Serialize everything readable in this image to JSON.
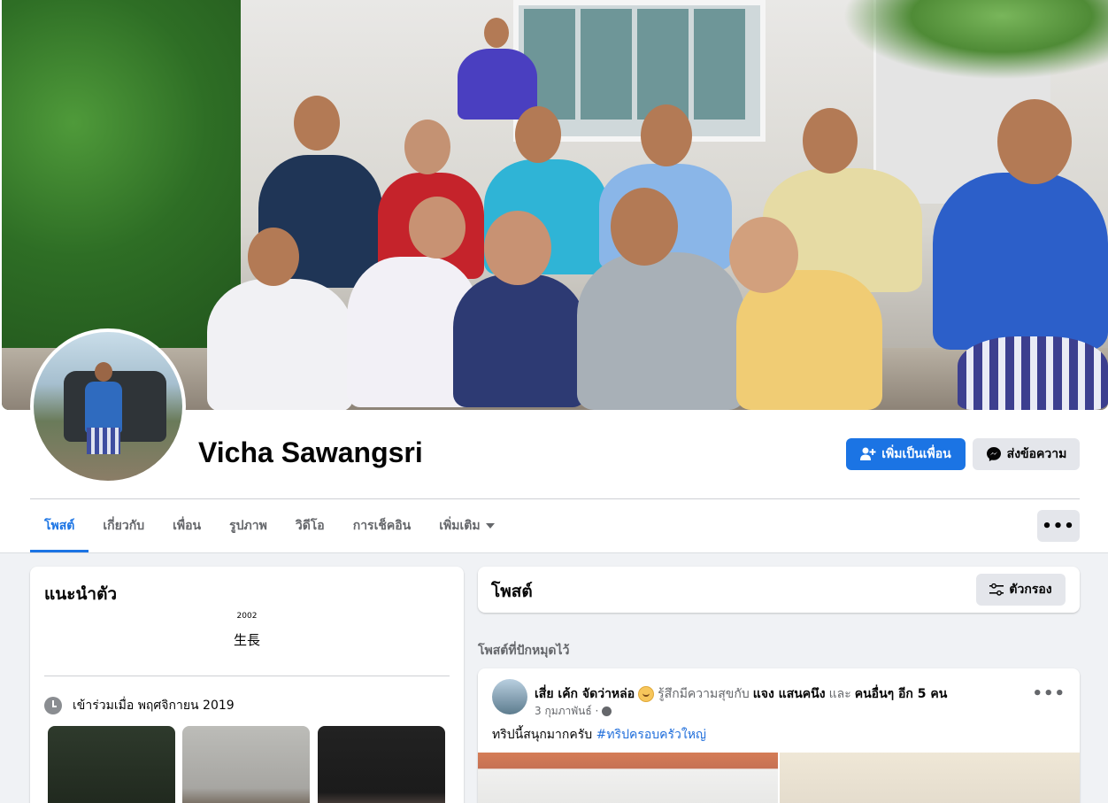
{
  "profile": {
    "name": "Vicha Sawangsri",
    "add_friend_label": "เพิ่มเป็นเพื่อน",
    "message_label": "ส่งข้อความ"
  },
  "tabs": [
    {
      "label": "โพสต์",
      "active": true
    },
    {
      "label": "เกี่ยวกับ",
      "active": false
    },
    {
      "label": "เพื่อน",
      "active": false
    },
    {
      "label": "รูปภาพ",
      "active": false
    },
    {
      "label": "วิดีโอ",
      "active": false
    },
    {
      "label": "การเช็คอิน",
      "active": false
    },
    {
      "label": "เพิ่มเติม",
      "active": false
    }
  ],
  "more_button_label": "•••",
  "intro": {
    "title": "แนะนำตัว",
    "year": "2002",
    "bio": "生長",
    "joined": "เข้าร่วมเมื่อ พฤศจิกายน 2019"
  },
  "posts_section": {
    "title": "โพสต์",
    "filter_label": "ตัวกรอง",
    "pinned_label": "โพสต์ที่ปักหมุดไว้"
  },
  "post": {
    "author": "เสี่ย เค้ก จัดว่าหล่อ",
    "feeling": "รู้สึกมีความสุขกับ",
    "tagged": "แจง แสนคนึง",
    "and_word": "และ",
    "others": "คนอื่นๆ อีก 5 คน",
    "date": "3 กุมภาพันธ์ ·",
    "text": "ทริปนี้สนุกมากครับ",
    "hashtag": "#ทริปครอบครัวใหญ่",
    "menu_label": "•••"
  },
  "colors": {
    "accent": "#1b74e4",
    "page_bg": "#f0f2f5",
    "secondary_button": "#e4e6eb",
    "muted_text": "#65676b"
  }
}
